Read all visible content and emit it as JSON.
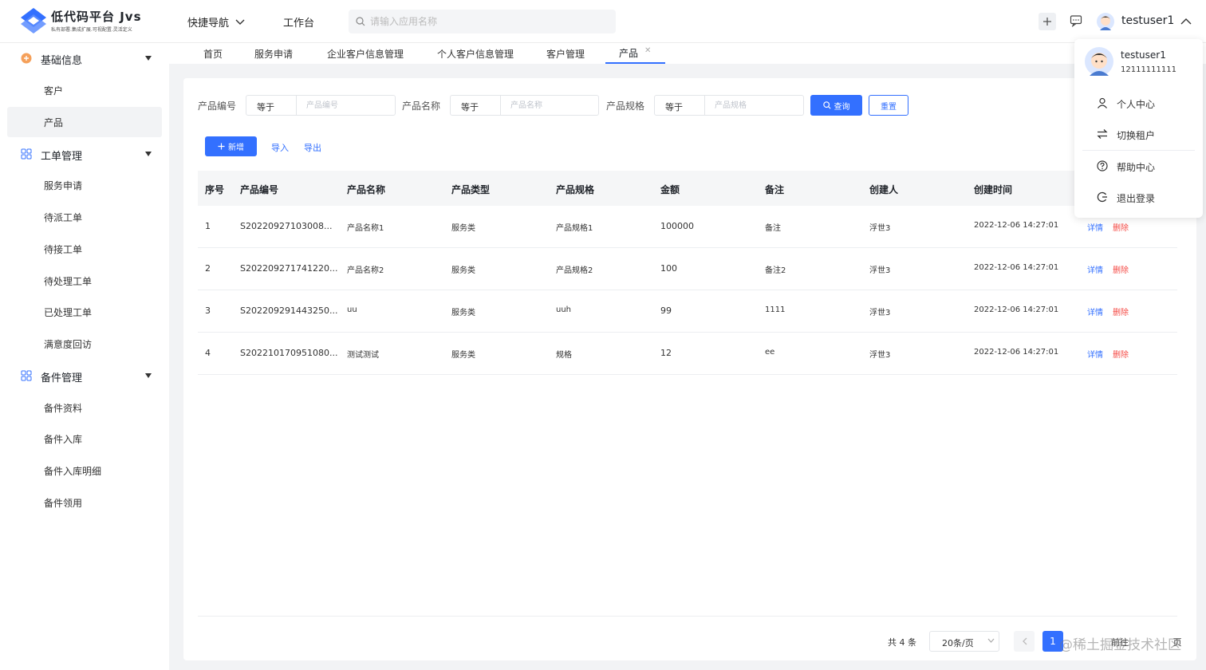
{
  "app": {
    "title": "低代码平台 Jvs",
    "subtitle": "私有部署.集成扩展.可视配置.灵活定义"
  },
  "header": {
    "quick_nav": "快捷导航",
    "workbench": "工作台",
    "search_placeholder": "请输入应用名称",
    "user_name": "testuser1"
  },
  "sidebar": {
    "groups": [
      {
        "label": "基础信息",
        "icon": "base-info-icon",
        "items": [
          "客户",
          "产品"
        ]
      },
      {
        "label": "工单管理",
        "icon": "grid-icon",
        "items": [
          "服务申请",
          "待派工单",
          "待接工单",
          "待处理工单",
          "已处理工单",
          "满意度回访"
        ]
      },
      {
        "label": "备件管理",
        "icon": "grid-icon",
        "items": [
          "备件资料",
          "备件入库",
          "备件入库明细",
          "备件领用"
        ]
      }
    ],
    "active_item": "产品"
  },
  "tabs": [
    "首页",
    "服务申请",
    "企业客户信息管理",
    "个人客户信息管理",
    "客户管理",
    "产品"
  ],
  "active_tab": "产品",
  "filters": [
    {
      "label": "产品编号",
      "operator": "等于",
      "placeholder": "产品编号"
    },
    {
      "label": "产品名称",
      "operator": "等于",
      "placeholder": "产品名称"
    },
    {
      "label": "产品规格",
      "operator": "等于",
      "placeholder": "产品规格"
    }
  ],
  "actions": {
    "query": "查询",
    "reset": "重置",
    "add": "新增",
    "import": "导入",
    "export": "导出"
  },
  "table": {
    "columns": [
      "序号",
      "产品编号",
      "产品名称",
      "产品类型",
      "产品规格",
      "金额",
      "备注",
      "创建人",
      "创建时间"
    ],
    "rows": [
      [
        "1",
        "S20220927103008...",
        "产品名称1",
        "服务类",
        "产品规格1",
        "100000",
        "备注",
        "浮世3",
        "2022-12-06 14:27:01"
      ],
      [
        "2",
        "S202209271741220...",
        "产品名称2",
        "服务类",
        "产品规格2",
        "100",
        "备注2",
        "浮世3",
        "2022-12-06 14:27:01"
      ],
      [
        "3",
        "S202209291443250...",
        "uu",
        "服务类",
        "uuh",
        "99",
        "1111",
        "浮世3",
        "2022-12-06 14:27:01"
      ],
      [
        "4",
        "S202210170951080...",
        "测试测试",
        "服务类",
        "规格",
        "12",
        "ee",
        "浮世3",
        "2022-12-06 14:27:01"
      ]
    ],
    "row_ops": {
      "detail": "详情",
      "delete": "删除"
    }
  },
  "pagination": {
    "total": "共 4 条",
    "page_size": "20条/页",
    "current_page": "1",
    "goto": "前往",
    "goto_suffix": "页"
  },
  "user_menu": {
    "name": "testuser1",
    "phone": "12111111111",
    "items": [
      {
        "label": "个人中心",
        "icon": "user-icon"
      },
      {
        "label": "切换租户",
        "icon": "switch-icon"
      },
      {
        "label": "帮助中心",
        "icon": "help-icon"
      },
      {
        "label": "退出登录",
        "icon": "logout-icon"
      }
    ]
  },
  "watermark": "@稀土掘金技术社区",
  "colors": {
    "primary": "#3370ff",
    "danger": "#f54a45",
    "page_bg": "#f2f3f5"
  }
}
